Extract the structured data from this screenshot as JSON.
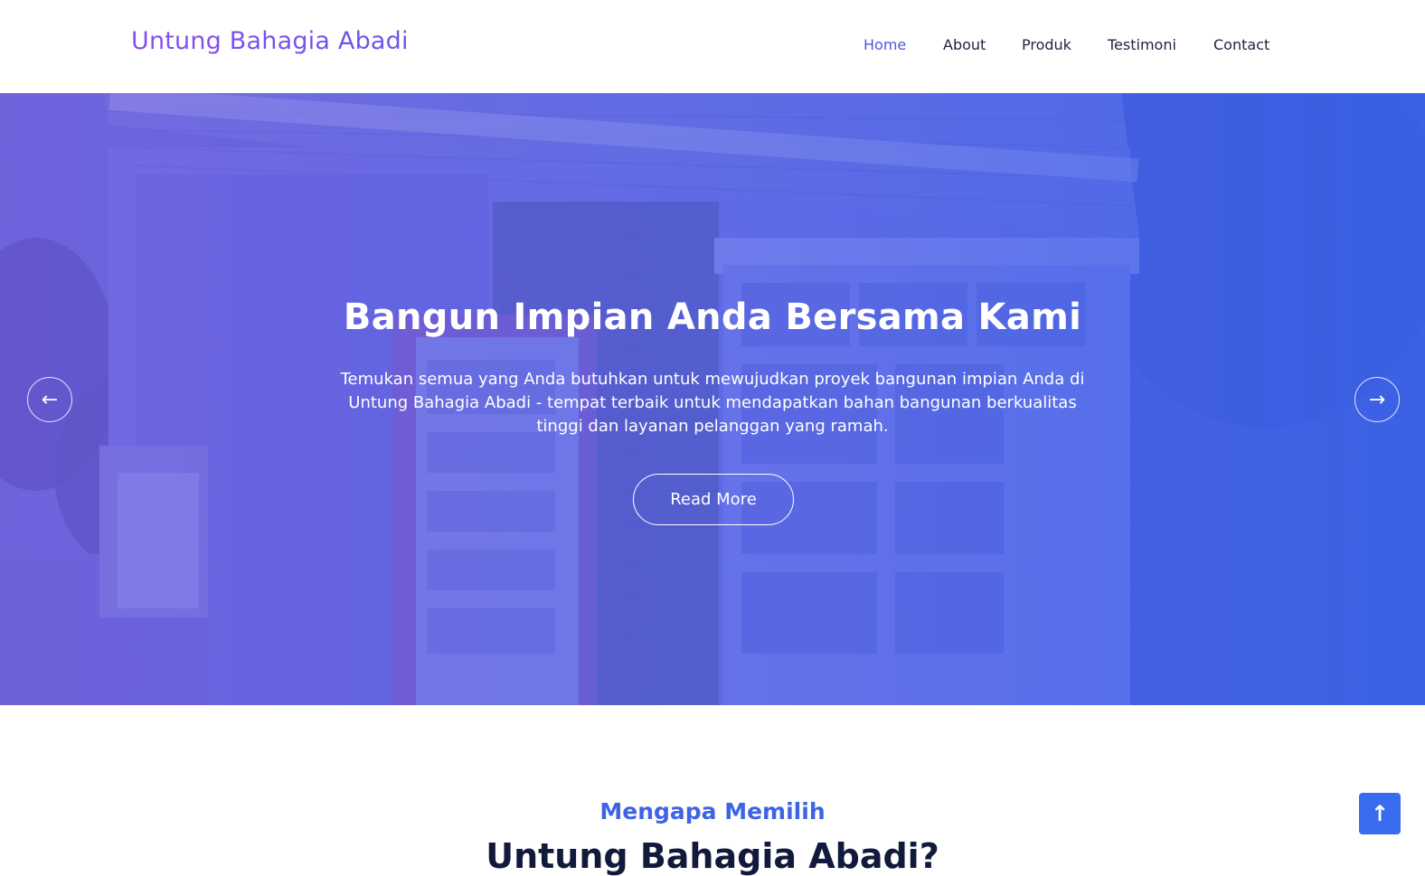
{
  "header": {
    "brand": "Untung Bahagia Abadi",
    "nav": [
      {
        "label": "Home",
        "active": true
      },
      {
        "label": "About",
        "active": false
      },
      {
        "label": "Produk",
        "active": false
      },
      {
        "label": "Testimoni",
        "active": false
      },
      {
        "label": "Contact",
        "active": false
      }
    ]
  },
  "hero": {
    "title": "Bangun Impian Anda Bersama Kami",
    "text": "Temukan semua yang Anda butuhkan untuk mewujudkan proyek bangunan impian Anda di Untung Bahagia Abadi - tempat terbaik untuk mendapatkan bahan bangunan berkualitas tinggi dan layanan pelanggan yang ramah.",
    "button_label": "Read More",
    "prev_icon": "arrow-left-icon",
    "next_icon": "arrow-right-icon",
    "prev_glyph": "←",
    "next_glyph": "→"
  },
  "section": {
    "eyebrow": "Mengapa Memilih",
    "title": "Untung Bahagia Abadi?"
  },
  "back_to_top": {
    "icon": "arrow-up-icon",
    "glyph": "↑"
  },
  "colors": {
    "brand_gradient_start": "#8b4cf0",
    "brand_gradient_end": "#6a55ec",
    "nav_active": "#4a5be0",
    "accent": "#3d63e6",
    "hero_overlay": "#5a5ee3",
    "back_to_top": "#3a6cf0"
  }
}
